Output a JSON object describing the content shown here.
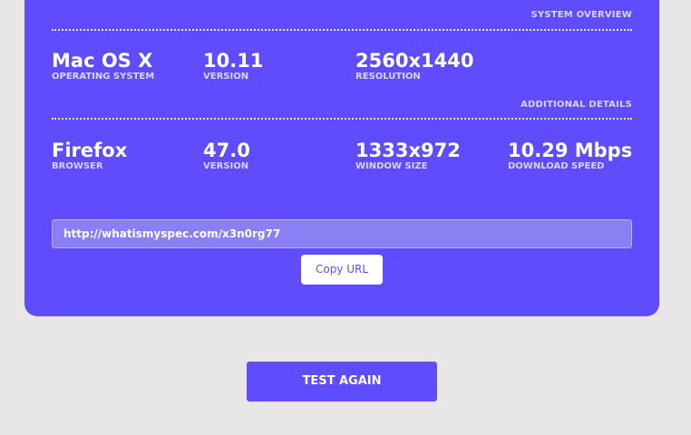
{
  "system_overview": {
    "heading": "SYSTEM OVERVIEW",
    "stats": [
      {
        "value": "Mac OS X",
        "label": "OPERATING SYSTEM"
      },
      {
        "value": "10.11",
        "label": "VERSION"
      },
      {
        "value": "2560x1440",
        "label": "RESOLUTION"
      }
    ]
  },
  "additional_details": {
    "heading": "ADDITIONAL DETAILS",
    "stats": [
      {
        "value": "Firefox",
        "label": "BROWSER"
      },
      {
        "value": "47.0",
        "label": "VERSION"
      },
      {
        "value": "1333x972",
        "label": "WINDOW SIZE"
      },
      {
        "value": "10.29 Mbps",
        "label": "DOWNLOAD SPEED"
      }
    ]
  },
  "share": {
    "url": "http://whatismyspec.com/x3n0rg77",
    "copy_label": "Copy URL"
  },
  "actions": {
    "test_again_label": "TEST AGAIN"
  },
  "colors": {
    "accent": "#5f4dfd",
    "background": "#e8e6e6"
  }
}
